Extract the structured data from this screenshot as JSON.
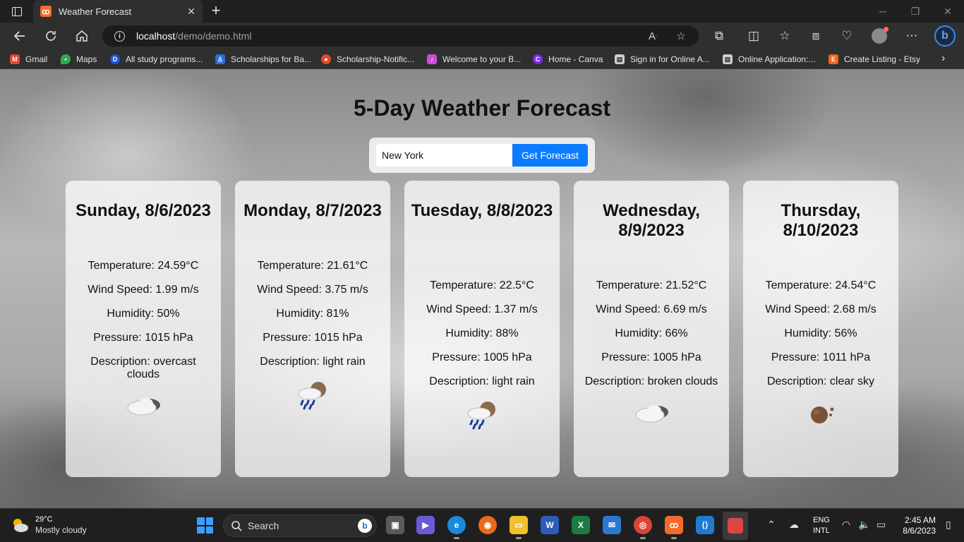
{
  "browser": {
    "tab": {
      "title": "Weather Forecast",
      "favicon": "xampp-icon"
    },
    "url": {
      "host": "localhost",
      "path": "/demo/demo.html"
    },
    "bookmarks": [
      {
        "label": "Gmail",
        "icon": "gmail-icon",
        "color": "#ea4335"
      },
      {
        "label": "Maps",
        "icon": "maps-icon",
        "color": "#34a853"
      },
      {
        "label": "All study programs...",
        "icon": "d-icon",
        "color": "#1a56db"
      },
      {
        "label": "Scholarships for Ba...",
        "icon": "person-icon",
        "color": "#2b6de0"
      },
      {
        "label": "Scholarship-Notific...",
        "icon": "circle-icon",
        "color": "#e24a2b"
      },
      {
        "label": "Welcome to your B...",
        "icon": "note-icon",
        "color": "#d14bd8"
      },
      {
        "label": "Home - Canva",
        "icon": "canva-icon",
        "color": "#7d2ae8"
      },
      {
        "label": "Sign in for Online A...",
        "icon": "doc-icon",
        "color": "#d0d0d0"
      },
      {
        "label": "Online Application:...",
        "icon": "doc-icon",
        "color": "#d0d0d0"
      },
      {
        "label": "Create Listing - Etsy",
        "icon": "etsy-icon",
        "color": "#f1641e"
      }
    ]
  },
  "page": {
    "title": "5-Day Weather Forecast",
    "search": {
      "value": "New York",
      "button": "Get Forecast"
    },
    "forecast": [
      {
        "day": "Sunday, 8/6/2023",
        "temperature": "Temperature: 24.59°C",
        "wind": "Wind Speed: 1.99 m/s",
        "humidity": "Humidity: 50%",
        "pressure": "Pressure: 1015 hPa",
        "description": "Description: overcast clouds",
        "icon": "overcast-clouds-icon"
      },
      {
        "day": "Monday, 8/7/2023",
        "temperature": "Temperature: 21.61°C",
        "wind": "Wind Speed: 3.75 m/s",
        "humidity": "Humidity: 81%",
        "pressure": "Pressure: 1015 hPa",
        "description": "Description: light rain",
        "icon": "light-rain-icon"
      },
      {
        "day": "Tuesday, 8/8/2023",
        "temperature": "Temperature: 22.5°C",
        "wind": "Wind Speed: 1.37 m/s",
        "humidity": "Humidity: 88%",
        "pressure": "Pressure: 1005 hPa",
        "description": "Description: light rain",
        "icon": "light-rain-icon"
      },
      {
        "day": "Wednesday, 8/9/2023",
        "temperature": "Temperature: 21.52°C",
        "wind": "Wind Speed: 6.69 m/s",
        "humidity": "Humidity: 66%",
        "pressure": "Pressure: 1005 hPa",
        "description": "Description: broken clouds",
        "icon": "broken-clouds-icon"
      },
      {
        "day": "Thursday, 8/10/2023",
        "temperature": "Temperature: 24.54°C",
        "wind": "Wind Speed: 2.68 m/s",
        "humidity": "Humidity: 56%",
        "pressure": "Pressure: 1011 hPa",
        "description": "Description: clear sky",
        "icon": "clear-sky-icon"
      }
    ]
  },
  "taskbar": {
    "weather": {
      "temp": "29°C",
      "desc": "Mostly cloudy"
    },
    "search_label": "Search",
    "lang_line1": "ENG",
    "lang_line2": "INTL",
    "time": "2:45 AM",
    "date": "8/6/2023",
    "accent": "#0a7cff"
  }
}
